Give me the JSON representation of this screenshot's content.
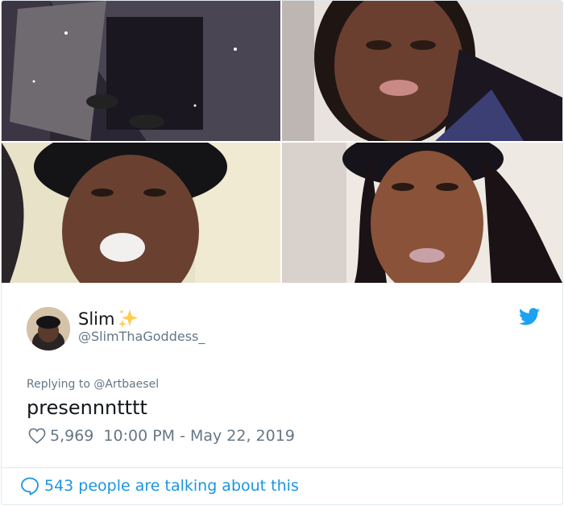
{
  "photos": [
    {
      "name": "photo-mirror-selfie",
      "description_icon": "photo"
    },
    {
      "name": "photo-closeup-lips",
      "description_icon": "photo"
    },
    {
      "name": "photo-durag-smoke",
      "description_icon": "photo"
    },
    {
      "name": "photo-durag-glow",
      "description_icon": "photo"
    }
  ],
  "tweet": {
    "display_name": "Slim",
    "handle": "@SlimThaGoddess_",
    "replying_prefix": "Replying to ",
    "replying_to": "@Artbaesel",
    "text": "presennntttt",
    "likes": "5,969",
    "timestamp": "10:00 PM - May 22, 2019",
    "talking": "543 people are talking about this"
  },
  "icons": {
    "sparkle": "sparkles-icon",
    "bird": "twitter-bird-icon",
    "heart": "heart-icon",
    "bubble": "speech-bubble-icon"
  },
  "colors": {
    "twitter_blue": "#1da1f2",
    "link_blue": "#1b95e0",
    "muted": "#657786",
    "sparkle": "#ffcc4d"
  }
}
